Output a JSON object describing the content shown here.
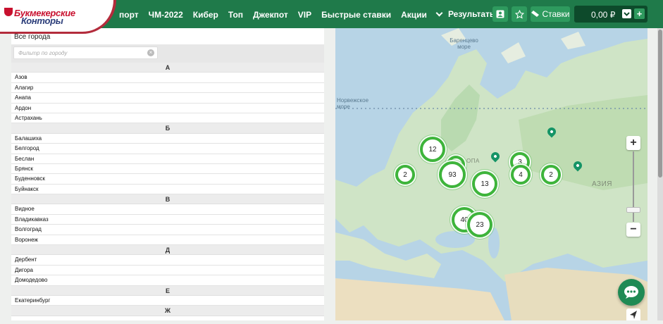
{
  "header": {
    "logo_line1": "Букмекерские",
    "logo_line2": "Конторы",
    "nav": [
      "порт",
      "ЧМ-2022",
      "Кибер",
      "Топ",
      "Джекпот",
      "VIP",
      "Быстрые ставки",
      "Акции",
      "Результаты"
    ],
    "bets_label": "Ставки",
    "balance": "0,00 ₽",
    "add_label": "+"
  },
  "city_list": {
    "title": "Все города",
    "filter_placeholder": "Фильтр по городу",
    "clear_glyph": "×",
    "groups": [
      {
        "letter": "А",
        "cities": [
          "Азов",
          "Алагир",
          "Анапа",
          "Ардон",
          "Астрахань"
        ]
      },
      {
        "letter": "Б",
        "cities": [
          "Балашиха",
          "Белгород",
          "Беслан",
          "Брянск",
          "Буденновск",
          "Буйнакск"
        ]
      },
      {
        "letter": "В",
        "cities": [
          "Видное",
          "Владикавказ",
          "Волгоград",
          "Воронеж"
        ]
      },
      {
        "letter": "Д",
        "cities": [
          "Дербент",
          "Дигора",
          "Домодедово"
        ]
      },
      {
        "letter": "Е",
        "cities": [
          "Екатеринбург"
        ]
      },
      {
        "letter": "Ж",
        "cities": []
      }
    ]
  },
  "map": {
    "labels": [
      "Баренцево море",
      "Норвежское море",
      "ОПА",
      "АЗИЯ"
    ],
    "clusters": [
      {
        "count": "12"
      },
      {
        "count": ""
      },
      {
        "count": "93"
      },
      {
        "count": "2"
      },
      {
        "count": "3"
      },
      {
        "count": "4"
      },
      {
        "count": "2"
      },
      {
        "count": "13"
      },
      {
        "count": "40"
      },
      {
        "count": "23"
      }
    ],
    "zoom_in": "+",
    "zoom_out": "−"
  },
  "colors": {
    "brand_green": "#1f7a4a",
    "cluster_green": "#3eb43b",
    "pin_green": "#159466"
  },
  "icons": [
    "user-icon",
    "star-icon",
    "ticket-icon",
    "check-icon",
    "plus-icon",
    "chat-icon",
    "locate-arrow-icon",
    "clear-icon",
    "chevron-down-icon"
  ]
}
